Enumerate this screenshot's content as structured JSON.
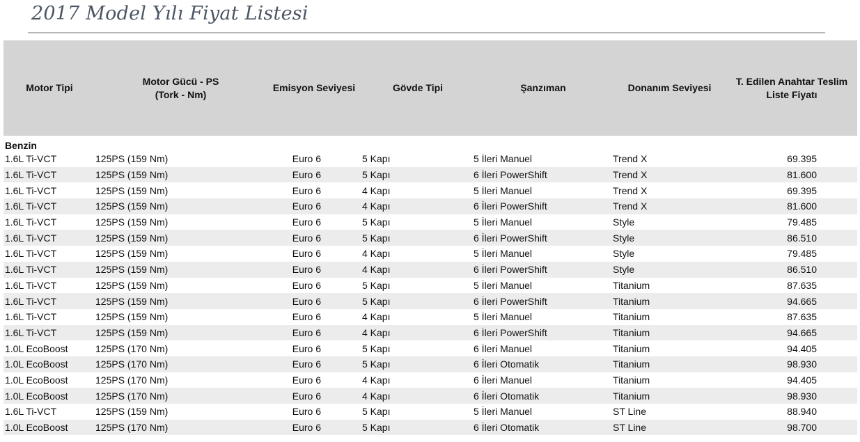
{
  "title": "2017 Model Yılı Fiyat Listesi",
  "table": {
    "headers": [
      [
        "Motor Tipi"
      ],
      [
        "Motor Gücü - PS",
        "(Tork - Nm)"
      ],
      [
        "Emisyon Seviyesi"
      ],
      [
        "Gövde Tipi"
      ],
      [
        "Şanzıman"
      ],
      [
        "Donanım Seviyesi"
      ],
      [
        "T. Edilen Anahtar Teslim",
        "Liste Fiyatı"
      ]
    ],
    "section": "Benzin",
    "rows": [
      [
        "1.6L Ti-VCT",
        "125PS (159 Nm)",
        "Euro 6",
        "5 Kapı",
        "5 İleri Manuel",
        "Trend X",
        "69.395"
      ],
      [
        "1.6L Ti-VCT",
        "125PS (159 Nm)",
        "Euro 6",
        "5 Kapı",
        "6 İleri PowerShift",
        "Trend X",
        "81.600"
      ],
      [
        "1.6L Ti-VCT",
        "125PS (159 Nm)",
        "Euro 6",
        "4 Kapı",
        "5 İleri Manuel",
        "Trend X",
        "69.395"
      ],
      [
        "1.6L Ti-VCT",
        "125PS (159 Nm)",
        "Euro 6",
        "4 Kapı",
        "6 İleri PowerShift",
        "Trend X",
        "81.600"
      ],
      [
        "1.6L Ti-VCT",
        "125PS (159 Nm)",
        "Euro 6",
        "5 Kapı",
        "5 İleri Manuel",
        "Style",
        "79.485"
      ],
      [
        "1.6L Ti-VCT",
        "125PS (159 Nm)",
        "Euro 6",
        "5 Kapı",
        "6 İleri PowerShift",
        "Style",
        "86.510"
      ],
      [
        "1.6L Ti-VCT",
        "125PS (159 Nm)",
        "Euro 6",
        "4 Kapı",
        "5 İleri Manuel",
        "Style",
        "79.485"
      ],
      [
        "1.6L Ti-VCT",
        "125PS (159 Nm)",
        "Euro 6",
        "4 Kapı",
        "6 İleri PowerShift",
        "Style",
        "86.510"
      ],
      [
        "1.6L Ti-VCT",
        "125PS (159 Nm)",
        "Euro 6",
        "5 Kapı",
        "5 İleri Manuel",
        "Titanium",
        "87.635"
      ],
      [
        "1.6L Ti-VCT",
        "125PS (159 Nm)",
        "Euro 6",
        "5 Kapı",
        "6 İleri PowerShift",
        "Titanium",
        "94.665"
      ],
      [
        "1.6L Ti-VCT",
        "125PS (159 Nm)",
        "Euro 6",
        "4 Kapı",
        "5 İleri Manuel",
        "Titanium",
        "87.635"
      ],
      [
        "1.6L Ti-VCT",
        "125PS (159 Nm)",
        "Euro 6",
        "4 Kapı",
        "6 İleri PowerShift",
        "Titanium",
        "94.665"
      ],
      [
        "1.0L EcoBoost",
        "125PS (170 Nm)",
        "Euro 6",
        "5 Kapı",
        "6 İleri Manuel",
        "Titanium",
        "94.405"
      ],
      [
        "1.0L EcoBoost",
        "125PS (170 Nm)",
        "Euro 6",
        "5 Kapı",
        "6 İleri Otomatik",
        "Titanium",
        "98.930"
      ],
      [
        "1.0L EcoBoost",
        "125PS (170 Nm)",
        "Euro 6",
        "4 Kapı",
        "6 İleri Manuel",
        "Titanium",
        "94.405"
      ],
      [
        "1.0L EcoBoost",
        "125PS (170 Nm)",
        "Euro 6",
        "4 Kapı",
        "6 İleri Otomatik",
        "Titanium",
        "98.930"
      ],
      [
        "1.6L Ti-VCT",
        "125PS (159 Nm)",
        "Euro 6",
        "5 Kapı",
        "5 İleri Manuel",
        "ST Line",
        "88.940"
      ],
      [
        "1.0L EcoBoost",
        "125PS (170 Nm)",
        "Euro 6",
        "5 Kapı",
        "6 İleri Otomatik",
        "ST Line",
        "98.700"
      ]
    ]
  },
  "colors": {
    "header_bg": "#d4d4d4",
    "zebra_bg": "#ececec",
    "title": "#4b5563",
    "rule": "#b7b7b7"
  }
}
